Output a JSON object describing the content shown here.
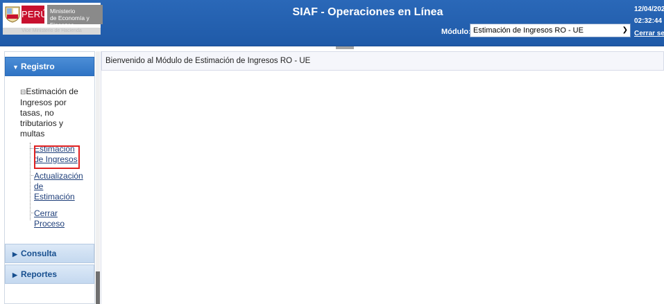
{
  "header": {
    "logo": {
      "peru": "PERÚ",
      "ministry_line1": "Ministerio",
      "ministry_line2": "de Economía y Finanzas",
      "sub": "Vice Ministerio de Hacienda"
    },
    "title": "SIAF - Operaciones en Línea",
    "modulo_label": "Módulo:",
    "modulo_value": "Estimación de Ingresos RO - UE",
    "date": "12/04/202",
    "time": "02:32:44",
    "logout": "Cerrar sesi"
  },
  "sidebar": {
    "sections": [
      {
        "label": "Registro",
        "expanded": true
      },
      {
        "label": "Consulta",
        "expanded": false
      },
      {
        "label": "Reportes",
        "expanded": false
      }
    ],
    "tree": {
      "root_line1": "Estimación de",
      "root_line2": "Ingresos por",
      "root_line3": "tasas, no",
      "root_line4": "tributarios y",
      "root_line5": "multas",
      "items": [
        {
          "line1": "Estimación",
          "line2": "de Ingresos"
        },
        {
          "line1": "Actualización",
          "line2": "de",
          "line3": "Estimación"
        },
        {
          "line1": "Cerrar",
          "line2": "Proceso"
        }
      ]
    }
  },
  "main": {
    "welcome": "Bienvenido al Módulo de Estimación de Ingresos RO - UE"
  },
  "colors": {
    "header_bg": "#1f5aa8",
    "active_section": "#2f74c4",
    "highlight": "#e02020"
  }
}
